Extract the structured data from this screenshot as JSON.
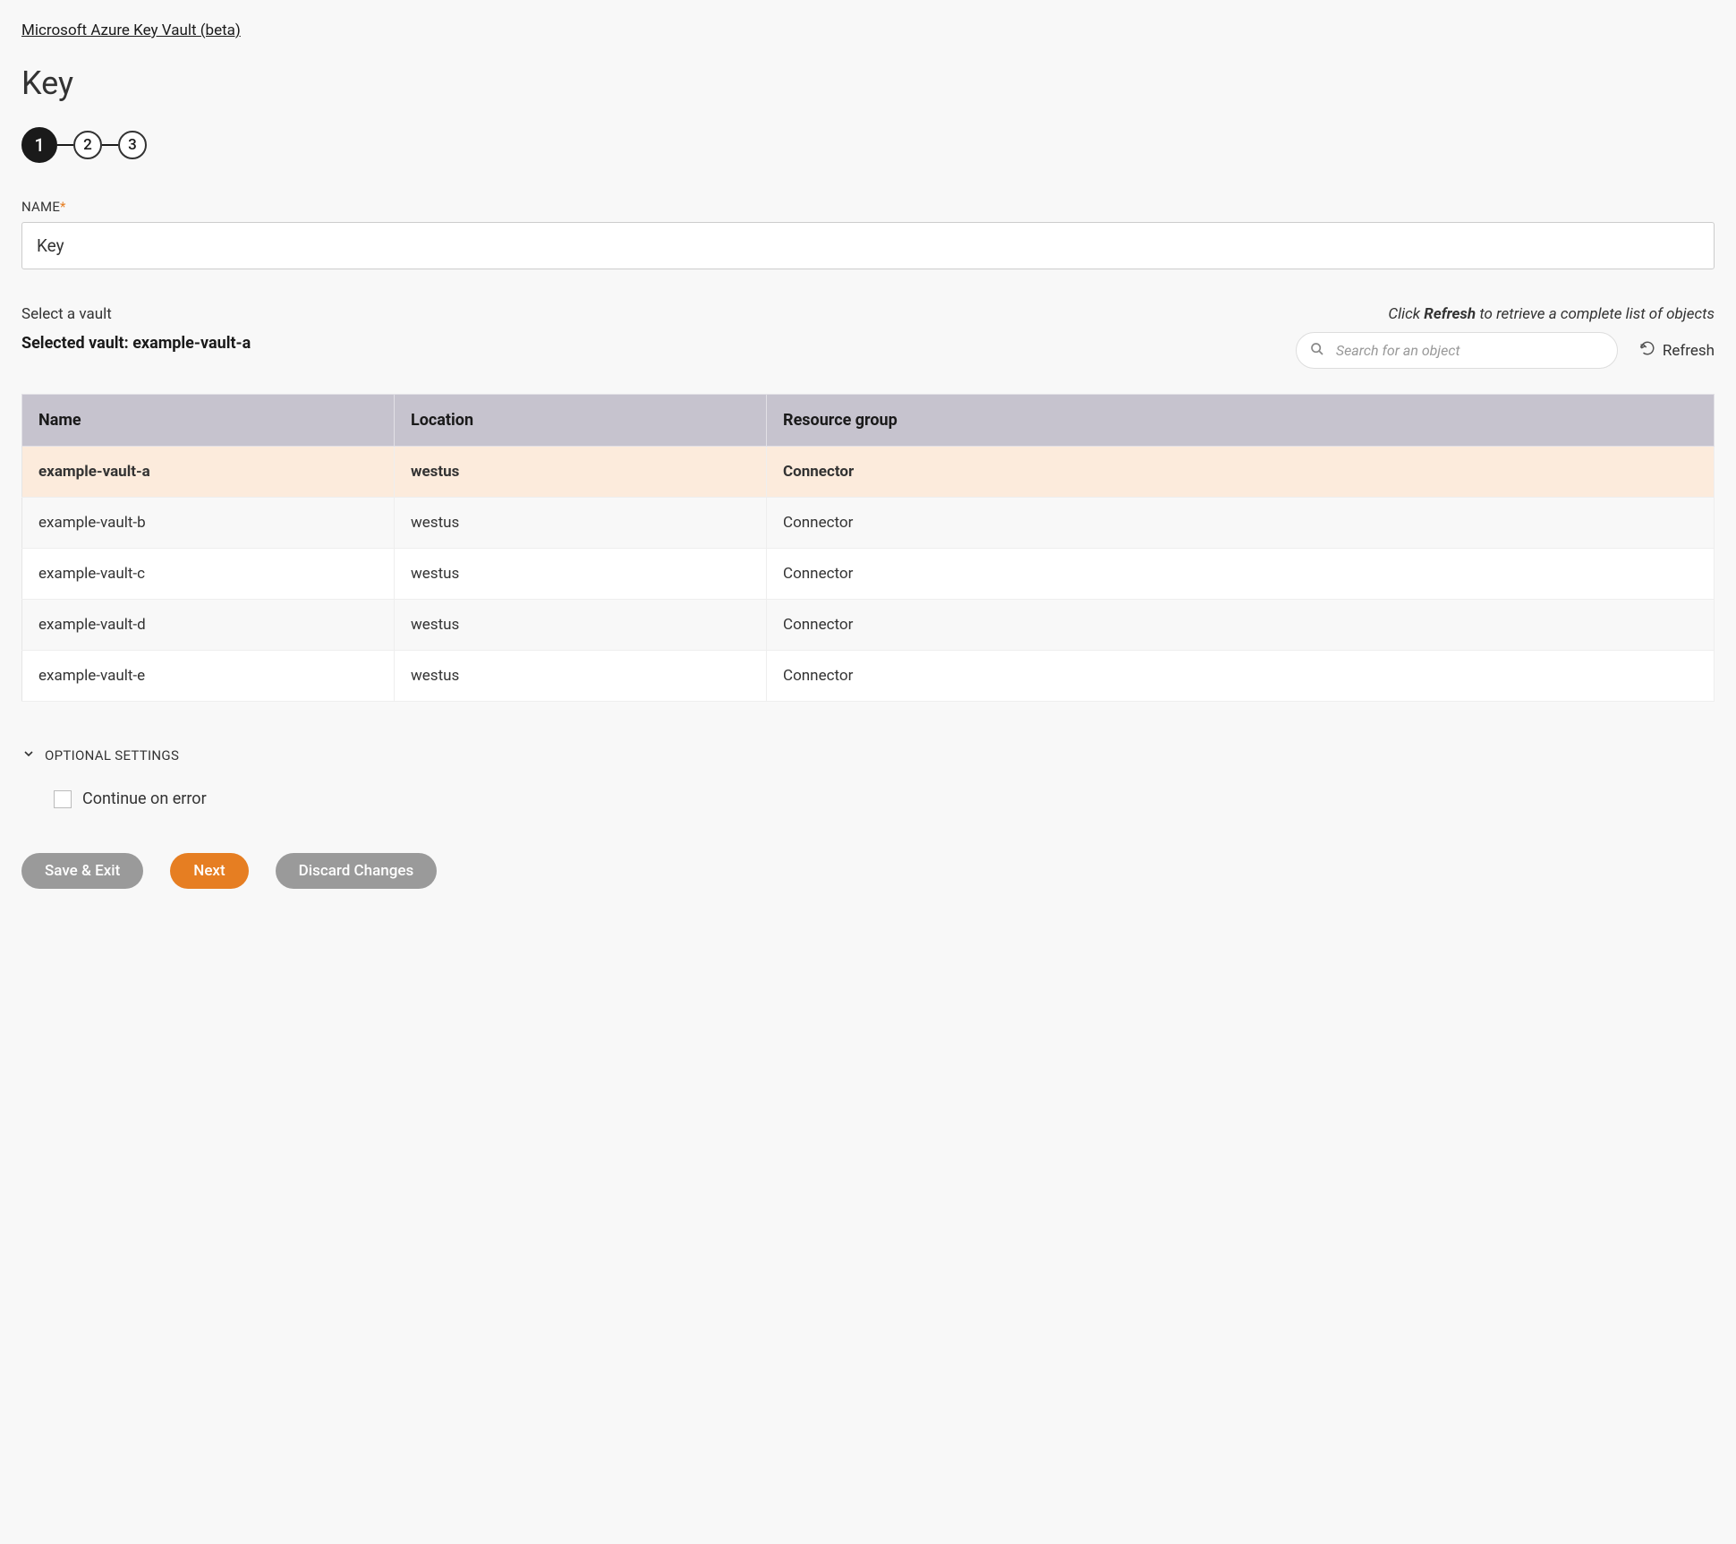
{
  "breadcrumb": {
    "text": "Microsoft Azure Key Vault (beta)"
  },
  "page": {
    "title": "Key"
  },
  "stepper": {
    "steps": [
      "1",
      "2",
      "3"
    ],
    "active_index": 0
  },
  "name_field": {
    "label": "NAME",
    "required_mark": "*",
    "value": "Key"
  },
  "vault_section": {
    "select_label": "Select a vault",
    "selected_prefix": "Selected vault: ",
    "selected_value": "example-vault-a",
    "hint_prefix": "Click ",
    "hint_bold": "Refresh",
    "hint_suffix": " to retrieve a complete list of objects",
    "search_placeholder": "Search for an object",
    "refresh_label": "Refresh"
  },
  "table": {
    "columns": [
      "Name",
      "Location",
      "Resource group"
    ],
    "rows": [
      {
        "name": "example-vault-a",
        "location": "westus",
        "resource_group": "Connector",
        "selected": true
      },
      {
        "name": "example-vault-b",
        "location": "westus",
        "resource_group": "Connector",
        "selected": false
      },
      {
        "name": "example-vault-c",
        "location": "westus",
        "resource_group": "Connector",
        "selected": false
      },
      {
        "name": "example-vault-d",
        "location": "westus",
        "resource_group": "Connector",
        "selected": false
      },
      {
        "name": "example-vault-e",
        "location": "westus",
        "resource_group": "Connector",
        "selected": false
      }
    ]
  },
  "optional": {
    "header": "OPTIONAL SETTINGS",
    "continue_on_error_label": "Continue on error",
    "continue_on_error_checked": false
  },
  "buttons": {
    "save_exit": "Save & Exit",
    "next": "Next",
    "discard": "Discard Changes"
  }
}
